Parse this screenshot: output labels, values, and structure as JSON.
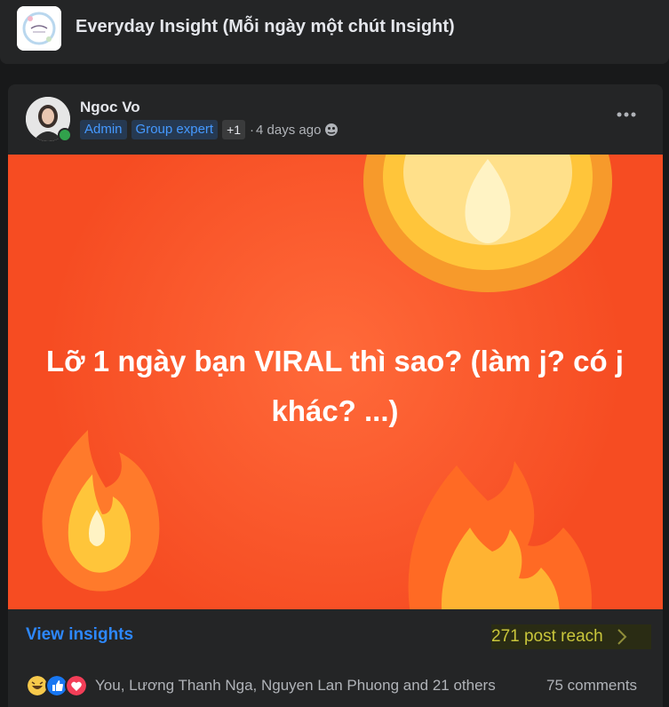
{
  "group": {
    "title": "Everyday Insight (Mỗi ngày một chút Insight)",
    "logo_icon": "group-logo-image"
  },
  "post": {
    "author": "Ngoc Vo",
    "badges": [
      "Admin",
      "Group expert"
    ],
    "extra_badges": "+1",
    "separator": "·",
    "time": "4 days ago",
    "audience_icon": "group-audience-icon",
    "image_text": "Lỡ 1 ngày bạn VIRAL thì sao? (làm j? có j khác? ...)"
  },
  "insights": {
    "view_label": "View insights",
    "reach_label": "271 post reach",
    "highlight_color": "#c9c63b"
  },
  "engagement": {
    "reaction_icons": [
      "haha-icon",
      "like-icon",
      "love-icon"
    ],
    "reaction_names": "You, Lương Thanh Nga, Nguyen Lan Phuong and 21 others",
    "comments": "75 comments"
  },
  "colors": {
    "background": "#18191a",
    "card": "#242526",
    "link_blue": "#2d88ff",
    "image_orange": "#f64c22"
  }
}
